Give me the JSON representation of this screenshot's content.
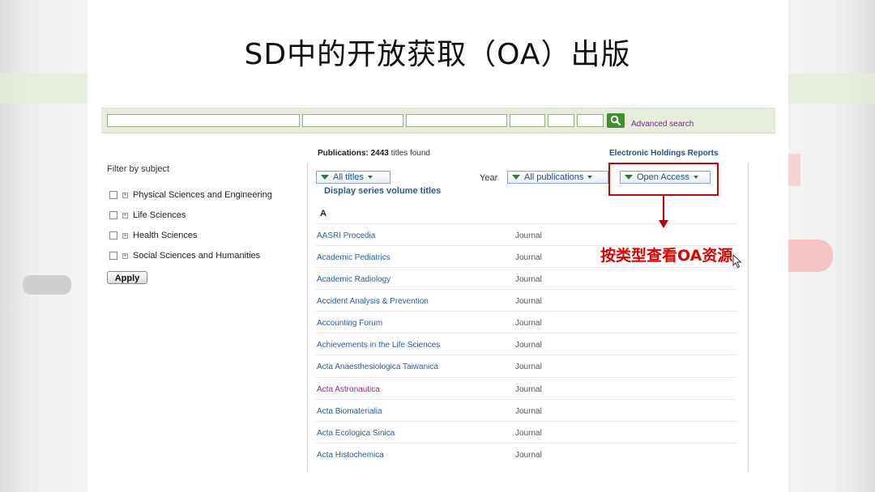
{
  "slide": {
    "title": "SD中的开放获取（OA）出版",
    "annotation": "按类型查看OA资源"
  },
  "search": {
    "advanced_label": "Advanced search",
    "go_icon": "magnifier-icon"
  },
  "sidebar": {
    "filter_title": "Filter by subject",
    "subjects": [
      {
        "label": "Physical Sciences and Engineering"
      },
      {
        "label": "Life Sciences"
      },
      {
        "label": "Health Sciences"
      },
      {
        "label": "Social Sciences and Humanities"
      }
    ],
    "apply_label": "Apply"
  },
  "results": {
    "publications_label": "Publications:",
    "count": "2443",
    "count_suffix": "titles found",
    "holdings_link": "Electronic Holdings Reports",
    "filter_titles": "All titles",
    "year_label": "Year",
    "filter_year": "All publications",
    "filter_access": "Open Access",
    "series_link": "Display series volume titles",
    "letter": "A",
    "rows": [
      {
        "title": "AASRI Procedia",
        "type": "Journal"
      },
      {
        "title": "Academic Pediatrics",
        "type": "Journal"
      },
      {
        "title": "Academic Radiology",
        "type": "Journal"
      },
      {
        "title": "Accident Analysis & Prevention",
        "type": "Journal"
      },
      {
        "title": "Accounting Forum",
        "type": "Journal"
      },
      {
        "title": "Achievements in the Life Sciences",
        "type": "Journal"
      },
      {
        "title": "Acta Anaesthesiologica Taiwanica",
        "type": "Journal"
      },
      {
        "title": "Acta Astronautica",
        "type": "Journal"
      },
      {
        "title": "Acta Biomaterialia",
        "type": "Journal"
      },
      {
        "title": "Acta Ecologica Sinica",
        "type": "Journal"
      },
      {
        "title": "Acta Histochemica",
        "type": "Journal"
      }
    ]
  },
  "colors": {
    "annotation": "#e00000",
    "link": "#2b5c9e",
    "visited_link": "#9b1f8a",
    "search_bar": "#e6eddd"
  }
}
